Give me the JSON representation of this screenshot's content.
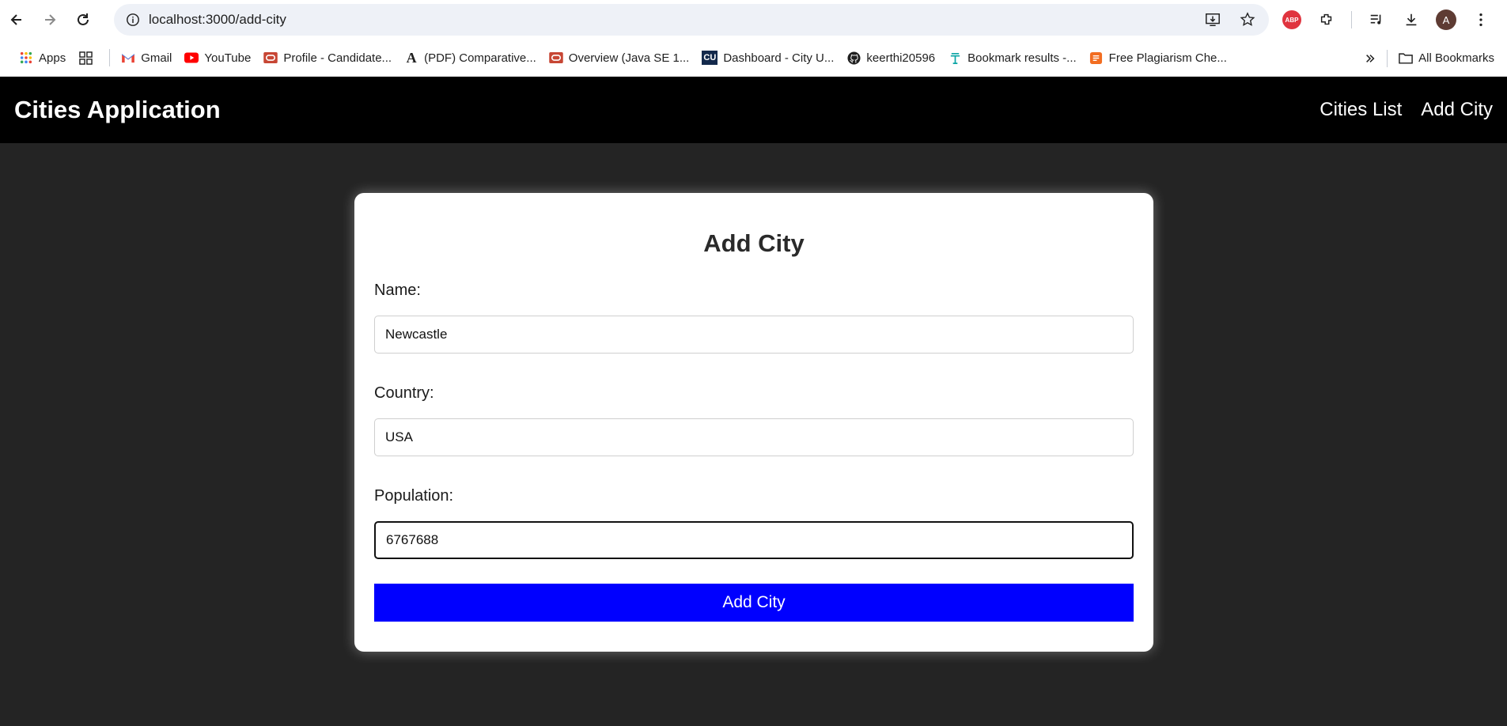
{
  "browser": {
    "url": "localhost:3000/add-city",
    "avatar_letter": "A",
    "abp_label": "ABP"
  },
  "bookmarks": {
    "items": [
      {
        "label": "Apps",
        "icon": "apps-grid-icon"
      },
      {
        "label": "Gmail",
        "icon": "gmail-icon"
      },
      {
        "label": "YouTube",
        "icon": "youtube-icon"
      },
      {
        "label": "Profile - Candidate...",
        "icon": "oracle-icon"
      },
      {
        "label": "(PDF) Comparative...",
        "icon": "academia-icon"
      },
      {
        "label": "Overview (Java SE 1...",
        "icon": "oracle-icon"
      },
      {
        "label": "Dashboard - City U...",
        "icon": "cu-icon"
      },
      {
        "label": "keerthi20596",
        "icon": "github-icon"
      },
      {
        "label": "Bookmark results -...",
        "icon": "bookmark-results-icon"
      },
      {
        "label": "Free Plagiarism Che...",
        "icon": "plagiarism-icon"
      }
    ],
    "cu_badge": "CU",
    "academia_glyph": "A",
    "all_bookmarks_label": "All Bookmarks"
  },
  "app": {
    "title": "Cities Application",
    "nav": [
      "Cities List",
      "Add City"
    ]
  },
  "form": {
    "heading": "Add City",
    "fields": [
      {
        "label": "Name:",
        "value": "Newcastle"
      },
      {
        "label": "Country:",
        "value": "USA"
      },
      {
        "label": "Population:",
        "value": "6767688"
      }
    ],
    "submit_label": "Add City"
  },
  "colors": {
    "header_bg": "#000000",
    "page_bg": "#242424",
    "submit_bg": "#0000ff"
  }
}
